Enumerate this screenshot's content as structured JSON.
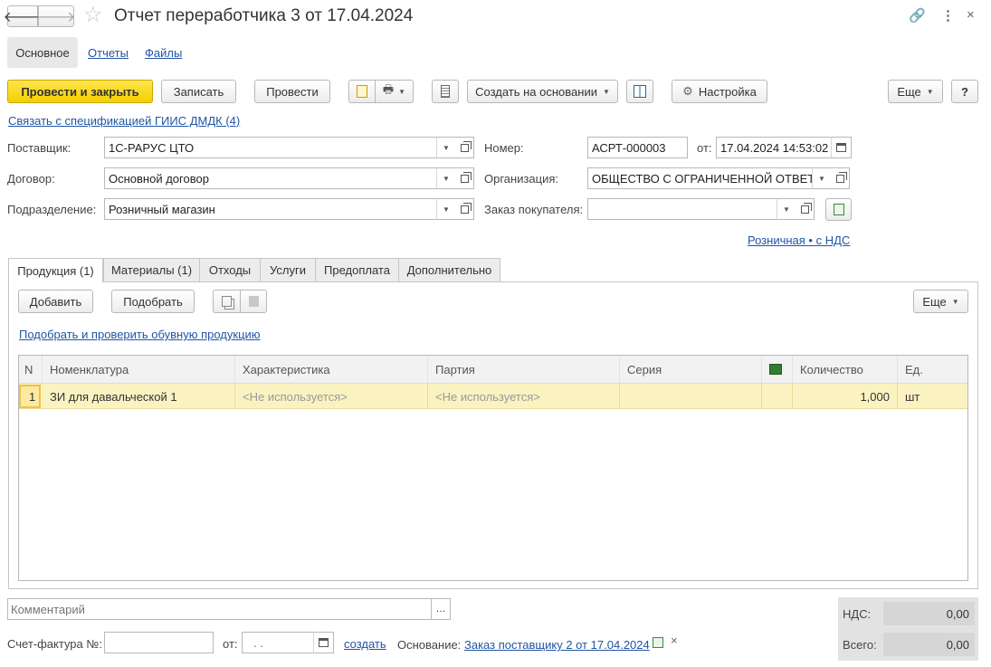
{
  "header": {
    "title": "Отчет переработчика 3 от 17.04.2024"
  },
  "nav": {
    "main": "Основное",
    "reports": "Отчеты",
    "files": "Файлы"
  },
  "toolbar": {
    "post_close": "Провести и закрыть",
    "save": "Записать",
    "post": "Провести",
    "create_based": "Создать на основании",
    "settings": "Настройка",
    "more": "Еще",
    "help": "?"
  },
  "link_spec": "Связать с спецификацией ГИИС ДМДК (4)",
  "form": {
    "supplier_label": "Поставщик:",
    "supplier": "1С-РАРУС ЦТО",
    "contract_label": "Договор:",
    "contract": "Основной договор",
    "division_label": "Подразделение:",
    "division": "Розничный магазин",
    "number_label": "Номер:",
    "number": "АСРТ-000003",
    "date_label": "от:",
    "date": "17.04.2024 14:53:02",
    "org_label": "Организация:",
    "org": "ОБЩЕСТВО С ОГРАНИЧЕННОЙ ОТВЕТСТВЕННОСТЬЮ",
    "order_label": "Заказ покупателя:",
    "order": "",
    "price_link": "Розничная • с НДС"
  },
  "tabs": [
    "Продукция (1)",
    "Материалы (1)",
    "Отходы",
    "Услуги",
    "Предоплата",
    "Дополнительно"
  ],
  "tab_toolbar": {
    "add": "Добавить",
    "pick": "Подобрать",
    "more": "Еще"
  },
  "shoe_link": "Подобрать и проверить обувную продукцию",
  "table": {
    "headers": {
      "n": "N",
      "item": "Номенклатура",
      "char": "Характеристика",
      "batch": "Партия",
      "series": "Серия",
      "qty": "Количество",
      "unit": "Ед."
    },
    "rows": [
      {
        "n": "1",
        "item": "ЗИ для давальческой 1",
        "char": "<Не используется>",
        "batch": "<Не используется>",
        "series": "",
        "qty": "1,000",
        "unit": "шт"
      }
    ]
  },
  "footer": {
    "comment_placeholder": "Комментарий",
    "invoice_label": "Счет-фактура №:",
    "invoice_date_label": "от:",
    "invoice_date": " .  .",
    "create_link": "создать",
    "basis_label": "Основание:",
    "basis_link": "Заказ поставщику 2 от 17.04.2024",
    "vat_label": "НДС:",
    "vat": "0,00",
    "total_label": "Всего:",
    "total": "0,00"
  }
}
